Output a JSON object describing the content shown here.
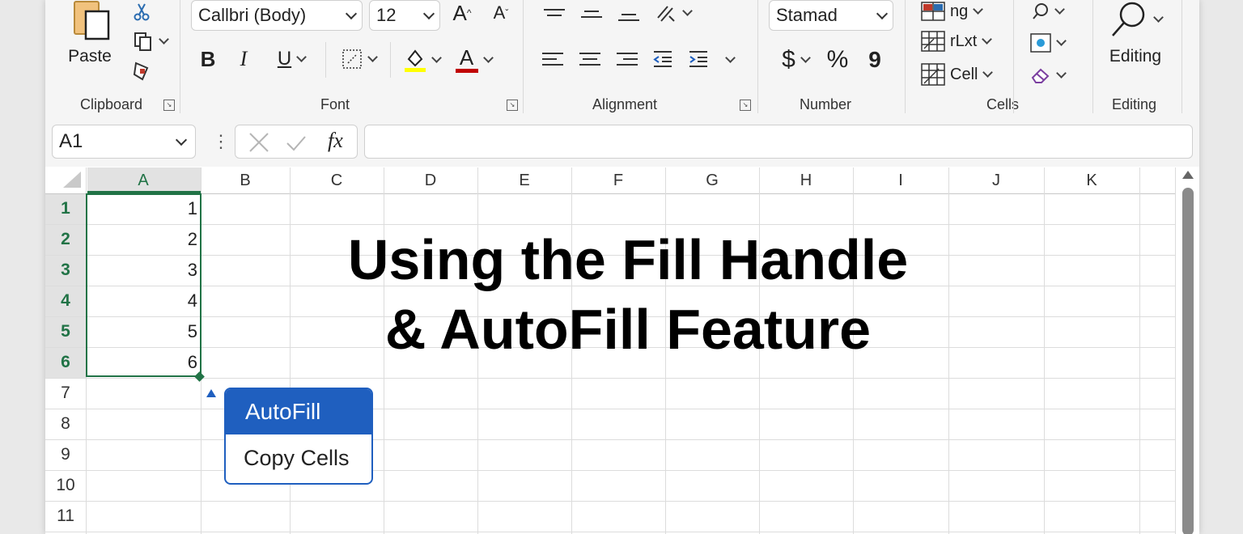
{
  "ribbon": {
    "clipboard": {
      "paste_label": "Paste",
      "group_label": "Clipboard"
    },
    "font": {
      "font_name": "Callbri (Body)",
      "font_size": "12",
      "bold": "B",
      "italic": "I",
      "underline": "U",
      "grow": "A",
      "shrink": "A",
      "font_color_glyph": "A",
      "group_label": "Font",
      "highlight_color": "#ffff00",
      "font_color": "#c00000"
    },
    "alignment": {
      "group_label": "Alignment"
    },
    "number": {
      "format": "Stamad",
      "currency": "$",
      "percent": "%",
      "comma": "9",
      "group_label": "Number"
    },
    "cells": {
      "items": [
        "ng",
        "rLxt",
        "Cell"
      ],
      "group_label": "Cells"
    },
    "editing": {
      "label": "Editing",
      "group_label": "Editing"
    }
  },
  "formula_bar": {
    "name_box": "A1",
    "fx": "fx",
    "dots": "⋮",
    "formula": ""
  },
  "sheet": {
    "columns": [
      "A",
      "B",
      "C",
      "D",
      "E",
      "F",
      "G",
      "H",
      "I",
      "J",
      "K"
    ],
    "rows": [
      "1",
      "2",
      "3",
      "4",
      "5",
      "6",
      "7",
      "8",
      "9",
      "10",
      "11"
    ],
    "values": [
      "1",
      "2",
      "3",
      "4",
      "5",
      "6"
    ],
    "selection_color": "#217346",
    "overlay_title_line1": "Using the Fill Handle",
    "overlay_title_line2": "& AutoFill Feature"
  },
  "autofill_menu": {
    "items": [
      "AutoFill",
      "Copy Cells"
    ],
    "accent": "#1f5fbf"
  }
}
